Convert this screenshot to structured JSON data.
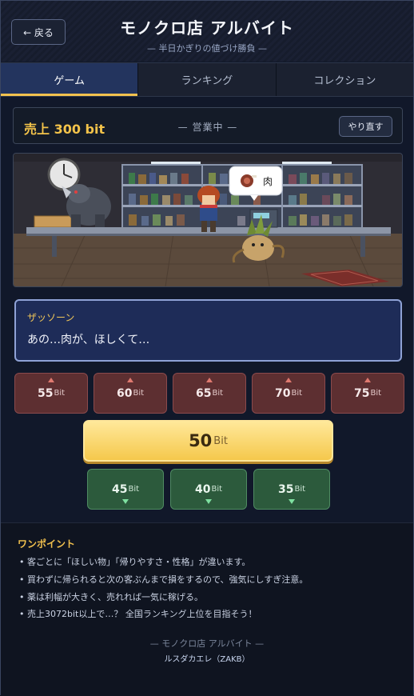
{
  "header": {
    "back_label": "← 戻る",
    "title": "モノクロ店 アルバイト",
    "subtitle": "— 半日かぎりの値づけ勝負 —"
  },
  "tabs": [
    {
      "label": "ゲーム",
      "active": true
    },
    {
      "label": "ランキング",
      "active": false
    },
    {
      "label": "コレクション",
      "active": false
    }
  ],
  "status_bar": {
    "sales": "売上 300 bit",
    "status": "— 営業中 —",
    "retry_label": "やり直す"
  },
  "scene": {
    "bubble_item": "肉",
    "bubble_icon": "meat-icon"
  },
  "dialog": {
    "speaker": "ザッソーン",
    "line": "あの…肉が、ほしくて…"
  },
  "price": {
    "unit": "Bit",
    "raise_options": [
      "55",
      "60",
      "65",
      "70",
      "75"
    ],
    "current": "50",
    "lower_options": [
      "45",
      "40",
      "35"
    ]
  },
  "tips": {
    "title": "ワンポイント",
    "items": [
      "• 客ごとに「ほしい物」「帰りやすさ・性格」が違います。",
      "• 買わずに帰られると次の客ぶんまで損をするので、強気にしすぎ注意。",
      "• 薬は利幅が大きく、売れれば一気に稼げる。",
      "• 売上3072bit以上で…？ 全国ランキング上位を目指そう！"
    ]
  },
  "footer": {
    "app_name": "— モノクロ店 アルバイト —",
    "credit": "ルスダカエレ（ZAKB）"
  },
  "colors": {
    "accent": "#f2c14e",
    "raise_button": "#5d2f31",
    "lower_button": "#2c5a3c",
    "current_price": "#f5c84c",
    "dialog_bg": "#1e2c58"
  }
}
